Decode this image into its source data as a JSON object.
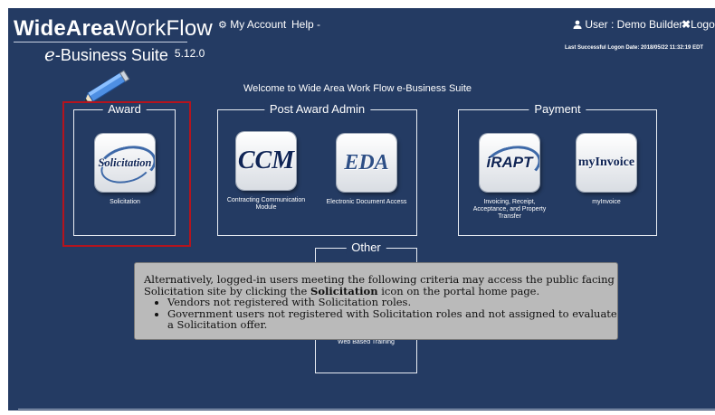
{
  "header": {
    "logo": {
      "bold": "WideArea",
      "regular": "WorkFlow",
      "suite_prefix": "e",
      "suite_name": "-Business Suite",
      "version": "5.12.0"
    },
    "nav": {
      "my_account": "My Account",
      "help": "Help -"
    },
    "user": {
      "label": "User : Demo Builder",
      "logout": "Logou"
    },
    "last_logon": "Last Successful Logon Date: 2018/05/22 11:32:19 EDT"
  },
  "welcome": "Welcome to Wide Area Work Flow e-Business Suite",
  "groups": {
    "award": {
      "title": "Award",
      "tiles": [
        {
          "icon_text": "Solicitation",
          "label": "Solicitation"
        }
      ]
    },
    "post_award": {
      "title": "Post Award Admin",
      "tiles": [
        {
          "icon_text": "CCM",
          "label": "Contracting Communication Module"
        },
        {
          "icon_text": "EDA",
          "label": "Electronic Document Access"
        }
      ]
    },
    "payment": {
      "title": "Payment",
      "tiles": [
        {
          "icon_text": "iRAPT",
          "label": "Invoicing, Receipt, Acceptance, and Property Transfer"
        },
        {
          "icon_text": "myInvoice",
          "label": "myInvoice"
        }
      ]
    },
    "other": {
      "title": "Other",
      "tiles": [
        {
          "label": "Web Based Training"
        }
      ]
    }
  },
  "tooltip": {
    "intro_before": "Alternatively, logged-in users meeting the following criteria may access the public facing Solicitation site by clicking the ",
    "intro_bold": "Solicitation",
    "intro_after": " icon on the portal home page.",
    "bullets": [
      "Vendors not registered with Solicitation roles.",
      "Government users not registered with Solicitation roles and not assigned to evaluate a Solicitation offer."
    ]
  },
  "icons": {
    "account": "gear-icon",
    "user": "user-icon",
    "logout": "close-icon",
    "annotation": "pencil-icon"
  },
  "colors": {
    "background": "#243b63",
    "highlight": "#b4141e",
    "tooltip": "#bababa",
    "icon_text": "#0f2455"
  }
}
